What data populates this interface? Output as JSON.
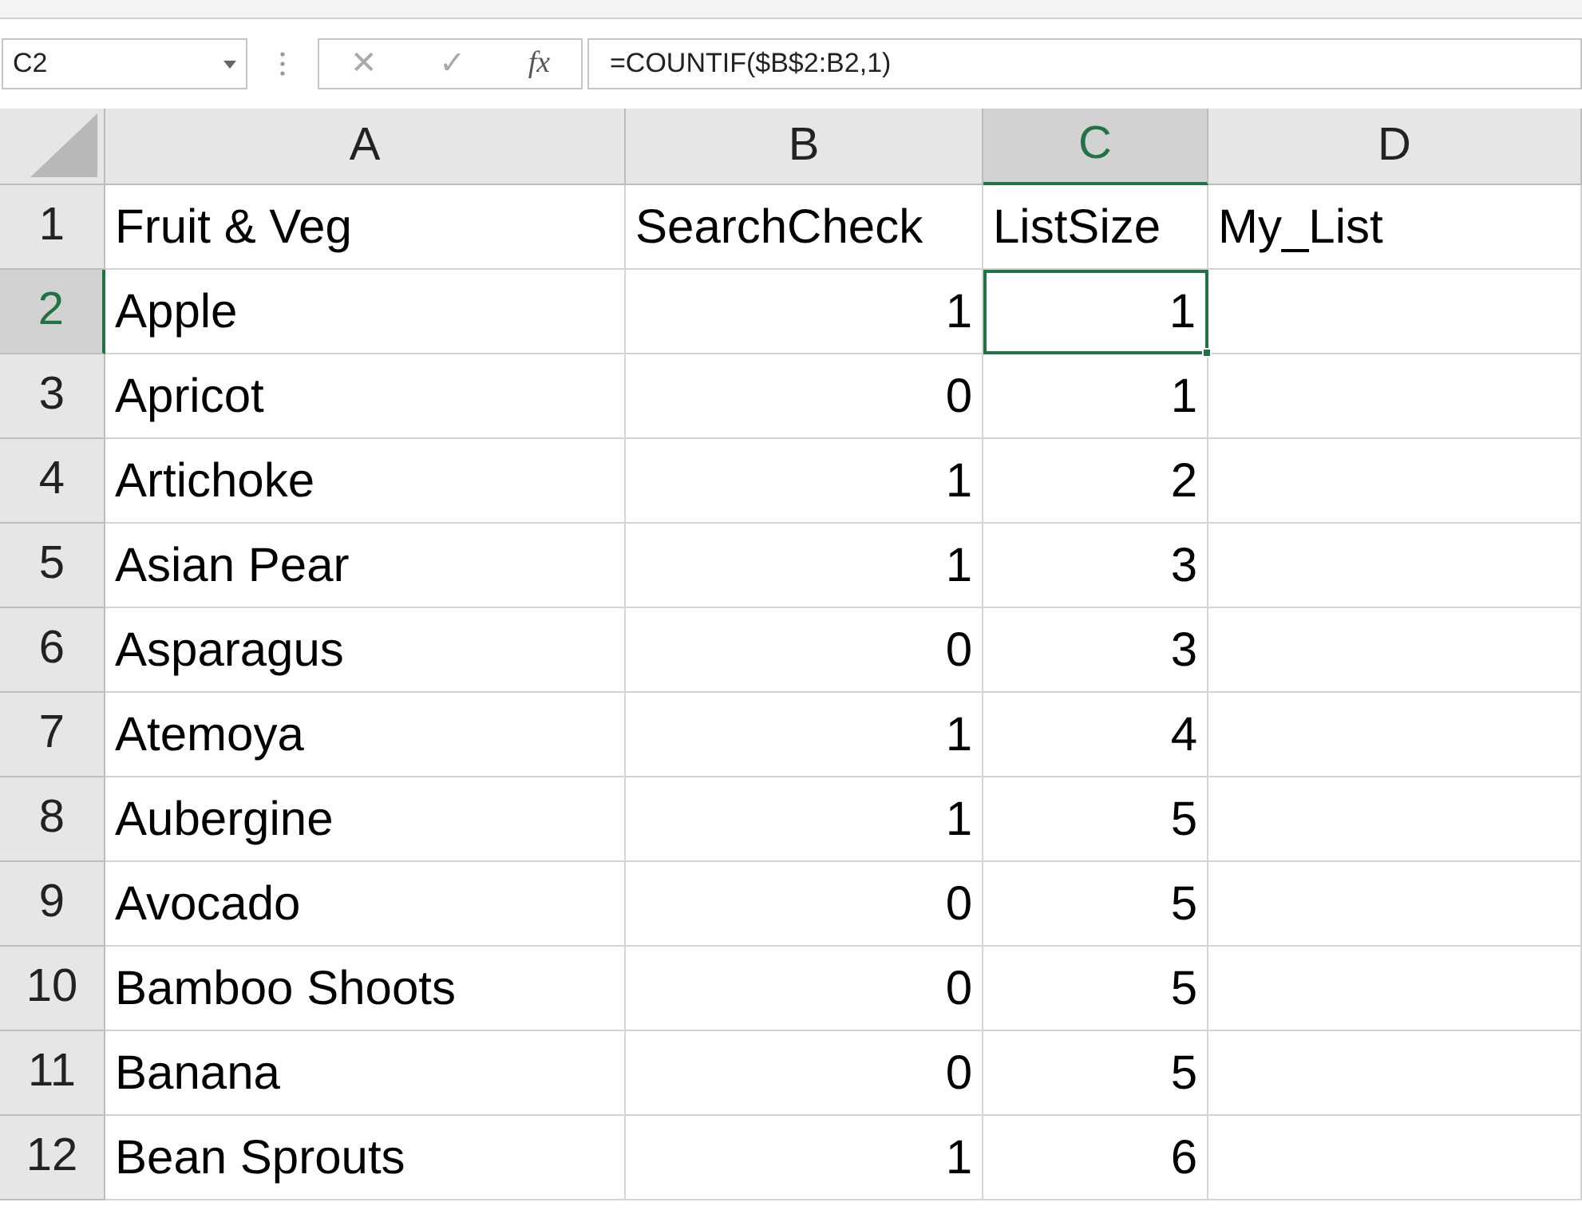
{
  "formula_bar": {
    "name_box": "C2",
    "cancel": "✕",
    "enter": "✓",
    "function": "fx",
    "formula": "=COUNTIF($B$2:B2,1)"
  },
  "columns": [
    {
      "label": "A",
      "selected": false
    },
    {
      "label": "B",
      "selected": false
    },
    {
      "label": "C",
      "selected": true
    },
    {
      "label": "D",
      "selected": false
    }
  ],
  "rows": [
    {
      "number": "1",
      "selected": false,
      "cells": [
        "Fruit & Veg",
        "SearchCheck",
        "ListSize",
        "My_List"
      ]
    },
    {
      "number": "2",
      "selected": true,
      "cells": [
        "Apple",
        "1",
        "1",
        ""
      ]
    },
    {
      "number": "3",
      "selected": false,
      "cells": [
        "Apricot",
        "0",
        "1",
        ""
      ]
    },
    {
      "number": "4",
      "selected": false,
      "cells": [
        "Artichoke",
        "1",
        "2",
        ""
      ]
    },
    {
      "number": "5",
      "selected": false,
      "cells": [
        "Asian Pear",
        "1",
        "3",
        ""
      ]
    },
    {
      "number": "6",
      "selected": false,
      "cells": [
        "Asparagus",
        "0",
        "3",
        ""
      ]
    },
    {
      "number": "7",
      "selected": false,
      "cells": [
        "Atemoya",
        "1",
        "4",
        ""
      ]
    },
    {
      "number": "8",
      "selected": false,
      "cells": [
        "Aubergine",
        "1",
        "5",
        ""
      ]
    },
    {
      "number": "9",
      "selected": false,
      "cells": [
        "Avocado",
        "0",
        "5",
        ""
      ]
    },
    {
      "number": "10",
      "selected": false,
      "cells": [
        "Bamboo Shoots",
        "0",
        "5",
        ""
      ]
    },
    {
      "number": "11",
      "selected": false,
      "cells": [
        "Banana",
        "0",
        "5",
        ""
      ]
    },
    {
      "number": "12",
      "selected": false,
      "cells": [
        "Bean Sprouts",
        "1",
        "6",
        ""
      ]
    }
  ]
}
